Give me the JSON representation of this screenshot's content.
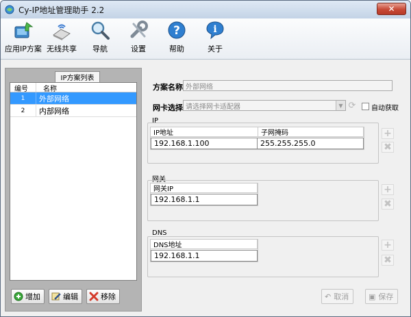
{
  "window": {
    "title": "Cy-IP地址管理助手 2.2",
    "close_glyph": "✕"
  },
  "toolbar": {
    "items": [
      {
        "label": "应用IP方案",
        "icon": "apply-ip-icon"
      },
      {
        "label": "无线共享",
        "icon": "wireless-share-icon"
      },
      {
        "label": "导航",
        "icon": "navigation-icon"
      },
      {
        "label": "设置",
        "icon": "settings-icon"
      },
      {
        "label": "帮助",
        "icon": "help-icon"
      },
      {
        "label": "关于",
        "icon": "about-icon"
      }
    ]
  },
  "scheme_list": {
    "tab_label": "IP方案列表",
    "columns": [
      "编号",
      "名称"
    ],
    "rows": [
      {
        "id": "1",
        "name": "外部网络",
        "selected": true
      },
      {
        "id": "2",
        "name": "内部网络",
        "selected": false
      }
    ],
    "buttons": {
      "add": "增加",
      "edit": "编辑",
      "remove": "移除"
    }
  },
  "form": {
    "scheme_name_label": "方案名称",
    "scheme_name_value": "外部网络",
    "adapter_label": "网卡选择",
    "adapter_placeholder": "请选择网卡适配器",
    "auto_obtain_label": "自动获取",
    "ip_group": {
      "title": "IP",
      "columns": [
        "IP地址",
        "子网掩码"
      ],
      "row": [
        "192.168.1.100",
        "255.255.255.0"
      ]
    },
    "gateway_group": {
      "title": "网关",
      "columns": [
        "网关IP"
      ],
      "row": [
        "192.168.1.1"
      ]
    },
    "dns_group": {
      "title": "DNS",
      "columns": [
        "DNS地址"
      ],
      "row": [
        "192.168.1.1"
      ]
    },
    "cancel_label": "取消",
    "save_label": "保存"
  },
  "colors": {
    "selection": "#3399ff",
    "close_button": "#c74a36",
    "title_bar": "#c3d3e6"
  }
}
